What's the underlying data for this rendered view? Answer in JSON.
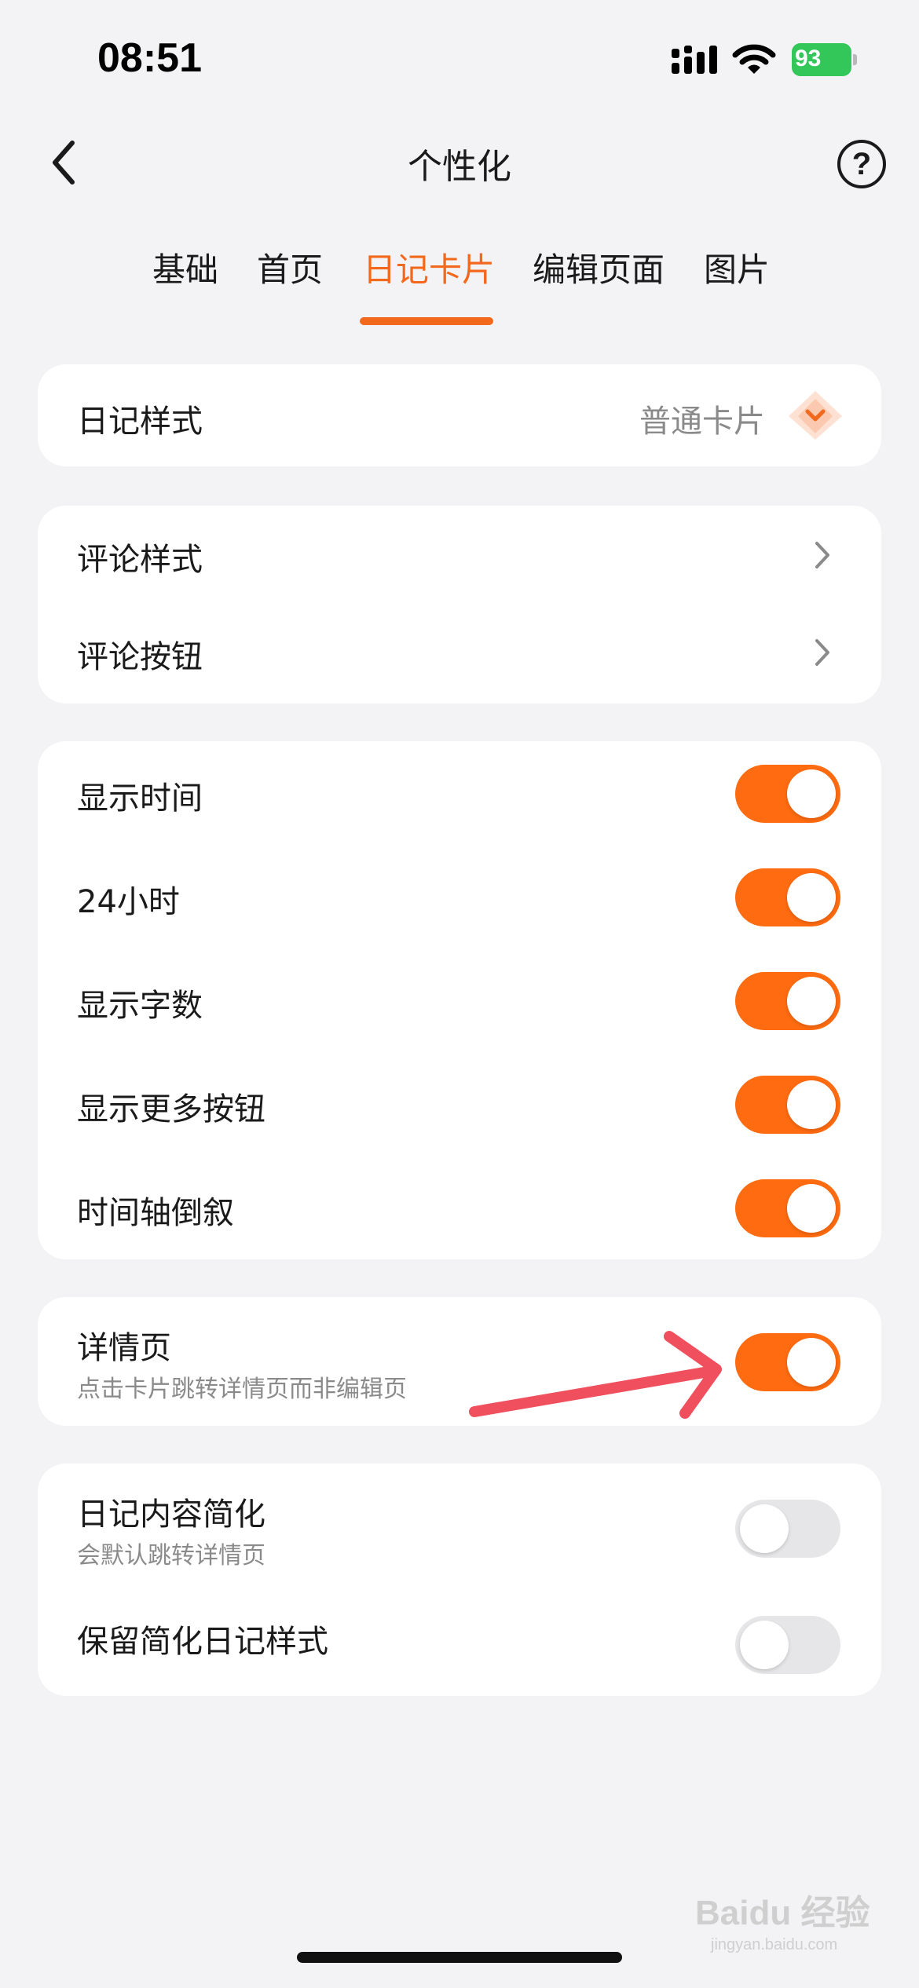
{
  "status_bar": {
    "time": "08:51",
    "battery": "93"
  },
  "nav": {
    "title": "个性化",
    "help": "?"
  },
  "tabs": [
    {
      "label": "基础",
      "active": false
    },
    {
      "label": "首页",
      "active": false
    },
    {
      "label": "日记卡片",
      "active": true
    },
    {
      "label": "编辑页面",
      "active": false
    },
    {
      "label": "图片",
      "active": false
    }
  ],
  "card_style": {
    "label": "日记样式",
    "value": "普通卡片"
  },
  "comments": [
    {
      "label": "评论样式"
    },
    {
      "label": "评论按钮"
    }
  ],
  "display_toggles": [
    {
      "label": "显示时间",
      "on": true
    },
    {
      "label": "24小时",
      "on": true
    },
    {
      "label": "显示字数",
      "on": true
    },
    {
      "label": "显示更多按钮",
      "on": true
    },
    {
      "label": "时间轴倒叙",
      "on": true
    }
  ],
  "detail": {
    "label": "详情页",
    "sub": "点击卡片跳转详情页而非编辑页",
    "on": true
  },
  "simplify": [
    {
      "label": "日记内容简化",
      "sub": "会默认跳转详情页",
      "on": false
    },
    {
      "label": "保留简化日记样式",
      "on": false
    }
  ],
  "watermark": {
    "main": "Bai",
    "suffix": "du 经验",
    "sub": "jingyan.baidu.com"
  },
  "colors": {
    "accent": "#f2681c",
    "toggle_on": "#ff6b10",
    "toggle_off": "#e6e6e8",
    "annotation": "#f0505e"
  }
}
